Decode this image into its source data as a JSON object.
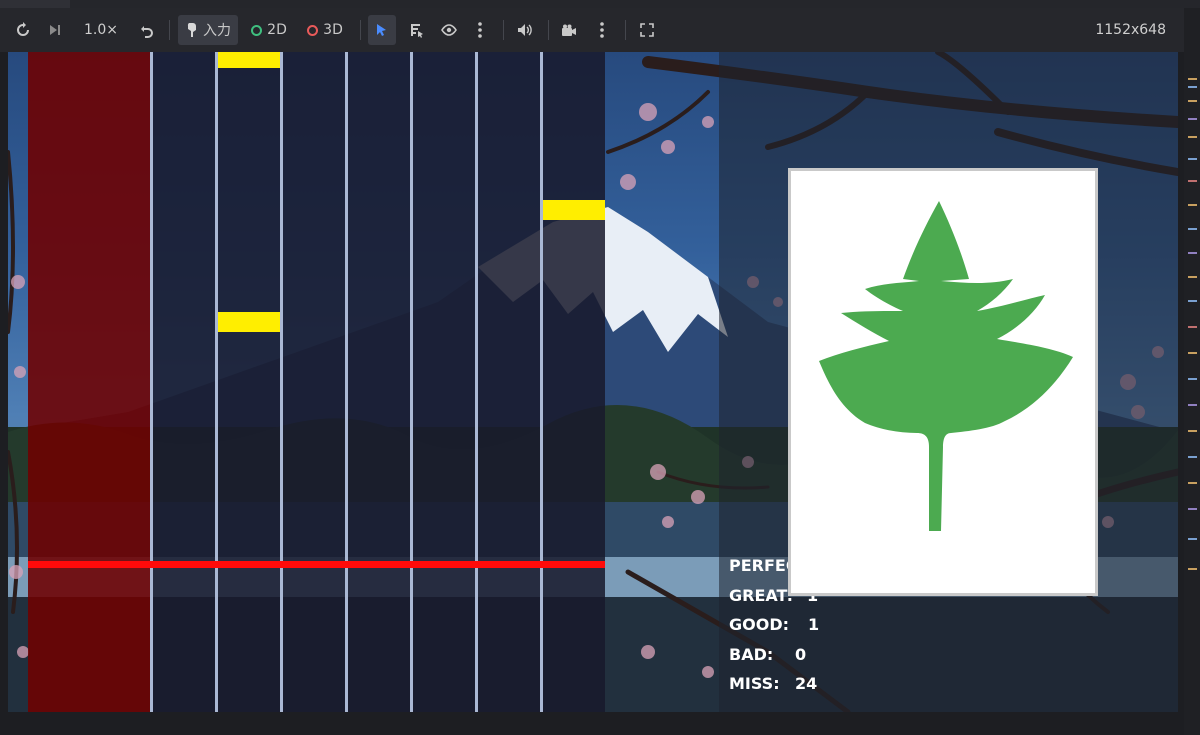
{
  "toolbar": {
    "speed": "1.0×",
    "input_label": "入力",
    "mode_2d_label": "2D",
    "mode_3d_label": "3D",
    "resolution": "1152x648",
    "icons": [
      "reload-icon",
      "step-forward-icon",
      "undo-icon",
      "input-icon",
      "select-arrow-icon",
      "list-pick-icon",
      "eye-icon",
      "more-vertical-icon",
      "speaker-icon",
      "camera-icon",
      "more-vertical-icon",
      "fullscreen-icon"
    ],
    "colors": {
      "mode_2d": "#3fbf7f",
      "mode_3d": "#e85a5a",
      "select_active": "#4a8cff"
    }
  },
  "game": {
    "stats": [
      {
        "label": "PERFEC",
        "value": ""
      },
      {
        "label": "GREAT:",
        "value": "1"
      },
      {
        "label": "GOOD:",
        "value": "1"
      },
      {
        "label": "BAD:",
        "value": "0"
      },
      {
        "label": "MISS:",
        "value": "24"
      }
    ],
    "card_icon": "green-leaf-icon",
    "colors": {
      "note": "#ffee00",
      "judge_line": "#ff0a0a",
      "leaf": "#4caa50",
      "active_lane": "#6e0000"
    }
  }
}
